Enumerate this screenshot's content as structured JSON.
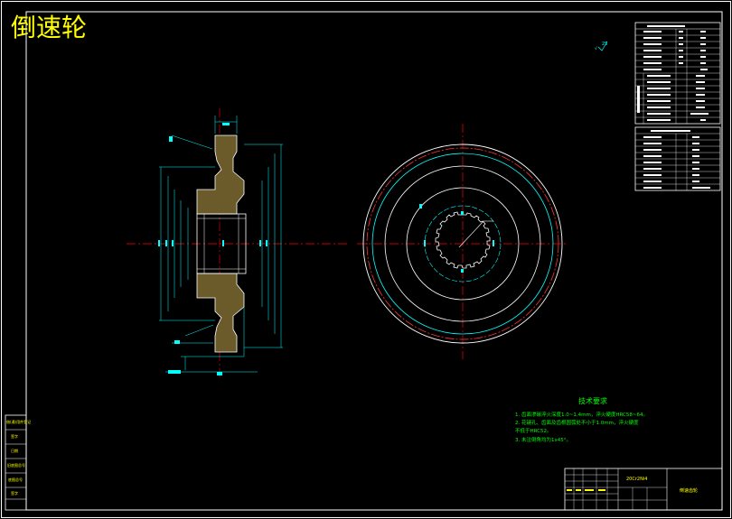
{
  "drawing": {
    "title": "倒速轮"
  },
  "roughness": {
    "label": "25",
    "prefix": "√"
  },
  "tech_requirements": {
    "heading": "技术要求",
    "items": [
      "1. 齿面渗碳淬火深度1.0~1.4mm，淬火硬度HRC58~64。",
      "2. 花键孔、齿面及齿根圆弧处不小于1.0mm，淬火硬度",
      "   不低于HRC52。",
      "3. 未注倒角均为1x45°。"
    ]
  },
  "title_block": {
    "scale": "20Cr2Ni4",
    "part_name": "倒速齿轮"
  },
  "left_strip": {
    "labels": [
      "借(通)用件登记",
      "签字",
      "日期",
      "旧底图总号",
      "底图总号",
      "签字"
    ]
  },
  "colors": {
    "frame": "#ffffff",
    "text_yellow": "#ffff00",
    "dim_cyan": "#00ffff",
    "center_red": "#ff0000",
    "text_green": "#00ff00"
  }
}
